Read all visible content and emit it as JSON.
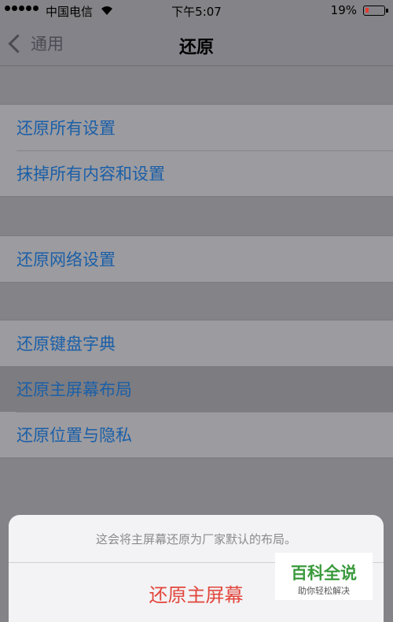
{
  "status_bar": {
    "carrier": "中国电信",
    "time": "下午5:07",
    "battery": "19%"
  },
  "nav": {
    "back_label": "通用",
    "title": "还原"
  },
  "groups": [
    {
      "items": [
        "还原所有设置",
        "抹掉所有内容和设置"
      ]
    },
    {
      "items": [
        "还原网络设置"
      ]
    },
    {
      "items": [
        "还原键盘字典",
        "还原主屏幕布局",
        "还原位置与隐私"
      ]
    }
  ],
  "action_sheet": {
    "message": "这会将主屏幕还原为厂家默认的布局。",
    "confirm_label": "还原主屏幕"
  },
  "watermark": {
    "main": "百科全说",
    "sub": "助你轻松解决"
  },
  "colors": {
    "link": "#1a5fa8",
    "destructive": "#e2473d",
    "battery_low": "#e43b2e"
  }
}
